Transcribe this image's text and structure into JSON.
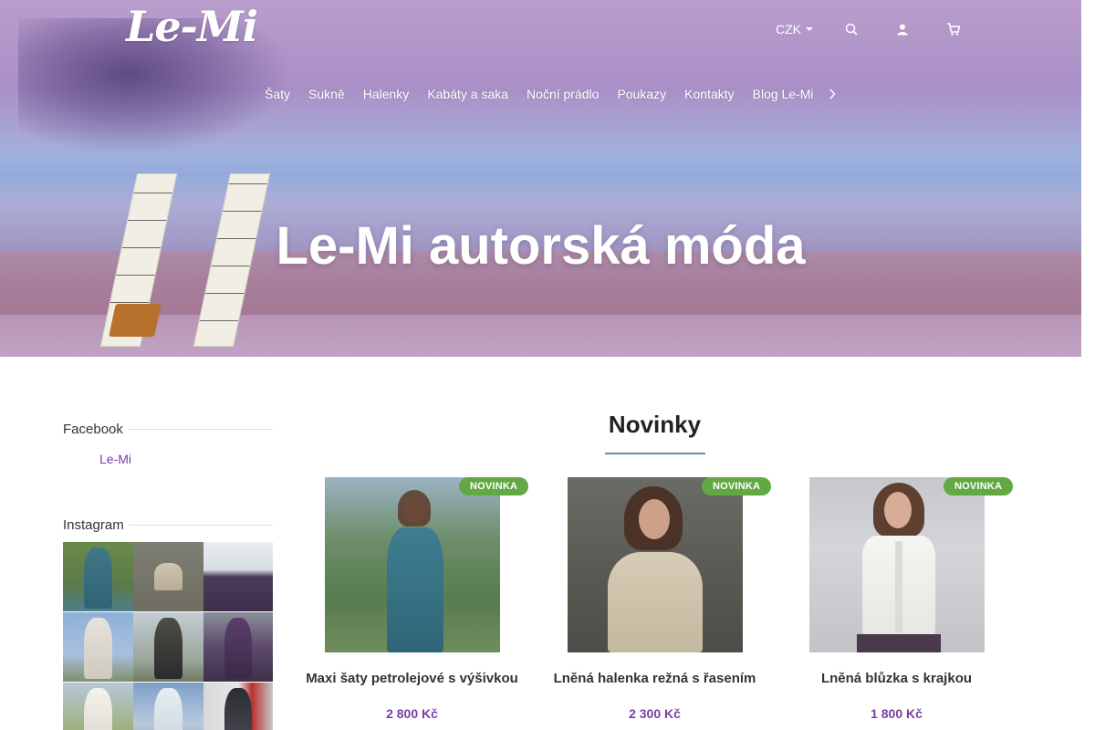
{
  "brand": {
    "logo_text": "Le-Mi"
  },
  "header": {
    "currency": "CZK",
    "icons": [
      "search-icon",
      "user-icon",
      "cart-icon"
    ]
  },
  "nav": {
    "items": [
      "Šaty",
      "Sukně",
      "Halenky",
      "Kabáty a saka",
      "Noční prádlo",
      "Poukazy",
      "Kontakty",
      "Blog Le-Mi"
    ],
    "more_icon": "chevron-right-icon"
  },
  "hero": {
    "title": "Le-Mi autorská móda"
  },
  "sidebar": {
    "facebook_heading": "Facebook",
    "facebook_link": "Le-Mi",
    "instagram_heading": "Instagram"
  },
  "main": {
    "section_title": "Novinky",
    "products": [
      {
        "badge": "NOVINKA",
        "name": "Maxi šaty petrolejové s výšivkou",
        "price": "2 800 Kč"
      },
      {
        "badge": "NOVINKA",
        "name": "Lněná halenka režná s řasením",
        "price": "2 300 Kč"
      },
      {
        "badge": "NOVINKA",
        "name": "Lněná blůzka s krajkou",
        "price": "1 800 Kč"
      }
    ]
  },
  "colors": {
    "accent": "#7b3ea3",
    "badge_green": "#62a944",
    "section_rule": "#6a8faa"
  }
}
